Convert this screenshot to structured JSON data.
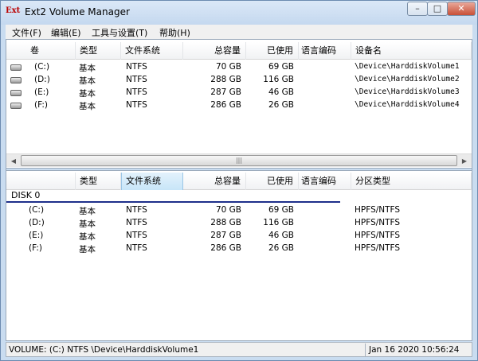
{
  "window": {
    "title": "Ext2 Volume Manager",
    "app_icon": "Ext"
  },
  "menu": [
    "文件(F)",
    "编辑(E)",
    "工具与设置(T)",
    "帮助(H)"
  ],
  "volumes_table": {
    "headers": [
      "卷",
      "类型",
      "文件系统",
      "总容量",
      "已使用",
      "语言编码",
      "设备名"
    ],
    "rows": [
      {
        "vol": "(C:)",
        "type": "基本",
        "fs": "NTFS",
        "total": "70 GB",
        "used": "69 GB",
        "codepage": "",
        "device": "\\Device\\HarddiskVolume1"
      },
      {
        "vol": "(D:)",
        "type": "基本",
        "fs": "NTFS",
        "total": "288 GB",
        "used": "116 GB",
        "codepage": "",
        "device": "\\Device\\HarddiskVolume2"
      },
      {
        "vol": "(E:)",
        "type": "基本",
        "fs": "NTFS",
        "total": "287 GB",
        "used": "46 GB",
        "codepage": "",
        "device": "\\Device\\HarddiskVolume3"
      },
      {
        "vol": "(F:)",
        "type": "基本",
        "fs": "NTFS",
        "total": "286 GB",
        "used": "26 GB",
        "codepage": "",
        "device": "\\Device\\HarddiskVolume4"
      }
    ]
  },
  "disks_table": {
    "headers": [
      "",
      "类型",
      "文件系统",
      "总容量",
      "已使用",
      "语言编码",
      "分区类型"
    ],
    "disk_label": "DISK 0",
    "rows": [
      {
        "vol": "(C:)",
        "type": "基本",
        "fs": "NTFS",
        "total": "70 GB",
        "used": "69 GB",
        "part": "HPFS/NTFS"
      },
      {
        "vol": "(D:)",
        "type": "基本",
        "fs": "NTFS",
        "total": "288 GB",
        "used": "116 GB",
        "part": "HPFS/NTFS"
      },
      {
        "vol": "(E:)",
        "type": "基本",
        "fs": "NTFS",
        "total": "287 GB",
        "used": "46 GB",
        "part": "HPFS/NTFS"
      },
      {
        "vol": "(F:)",
        "type": "基本",
        "fs": "NTFS",
        "total": "286 GB",
        "used": "26 GB",
        "part": "HPFS/NTFS"
      }
    ]
  },
  "status": {
    "left": "VOLUME: (C:) NTFS \\Device\\HarddiskVolume1",
    "right": "Jan 16 2020 10:56:24"
  }
}
